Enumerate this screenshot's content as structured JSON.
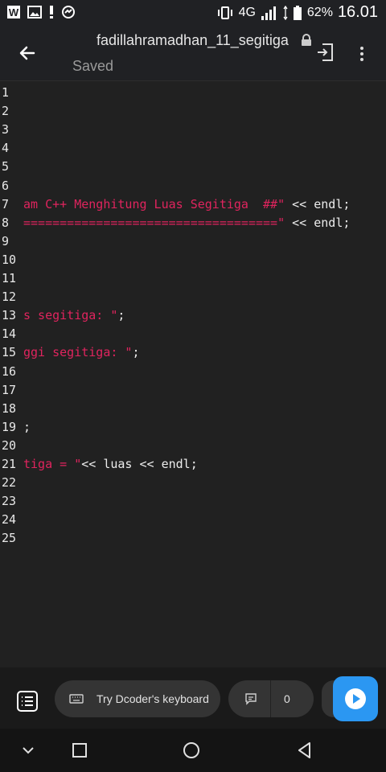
{
  "status_bar": {
    "network": "4G",
    "battery": "62%",
    "time": "16.01"
  },
  "app_bar": {
    "title": "fadillahramadhan_11_segitiga",
    "status": "Saved"
  },
  "editor": {
    "lines": [
      {
        "n": "1",
        "str": "",
        "rest": ""
      },
      {
        "n": "2",
        "str": "",
        "rest": ""
      },
      {
        "n": "3",
        "str": "",
        "rest": ""
      },
      {
        "n": "4",
        "str": "",
        "rest": ""
      },
      {
        "n": "5",
        "str": "",
        "rest": ""
      },
      {
        "n": "6",
        "str": "",
        "rest": ""
      },
      {
        "n": "7",
        "str": "am C++ Menghitung Luas Segitiga  ##\"",
        "rest": " << endl;"
      },
      {
        "n": "8",
        "str": "===================================\"",
        "rest": " << endl;"
      },
      {
        "n": "9",
        "str": "",
        "rest": ""
      },
      {
        "n": "10",
        "str": "",
        "rest": ""
      },
      {
        "n": "11",
        "str": "",
        "rest": ""
      },
      {
        "n": "12",
        "str": "",
        "rest": ""
      },
      {
        "n": "13",
        "str": "s segitiga: \"",
        "rest": ";"
      },
      {
        "n": "14",
        "str": "",
        "rest": ""
      },
      {
        "n": "15",
        "str": "ggi segitiga: \"",
        "rest": ";"
      },
      {
        "n": "16",
        "str": "",
        "rest": ""
      },
      {
        "n": "17",
        "str": "",
        "rest": ""
      },
      {
        "n": "18",
        "str": "",
        "rest": ""
      },
      {
        "n": "19",
        "str": "",
        "rest": ";"
      },
      {
        "n": "20",
        "str": "",
        "rest": ""
      },
      {
        "n": "21",
        "str": "tiga = \"",
        "rest": "<< luas << endl;"
      },
      {
        "n": "22",
        "str": "",
        "rest": ""
      },
      {
        "n": "23",
        "str": "",
        "rest": ""
      },
      {
        "n": "24",
        "str": "",
        "rest": ""
      },
      {
        "n": "25",
        "str": "",
        "rest": ""
      }
    ]
  },
  "toolbar": {
    "keyboard_label": "Try Dcoder's keyboard",
    "comment_count": "0"
  },
  "colors": {
    "string": "#e0245e",
    "run_button": "#2b97f2",
    "background": "#212121"
  },
  "icons": [
    "back-arrow-icon",
    "lock-icon",
    "export-icon",
    "more-vert-icon",
    "list-menu-icon",
    "keyboard-icon",
    "comment-icon",
    "play-icon",
    "nav-back-icon",
    "nav-home-icon",
    "nav-recents-icon",
    "nav-down-icon"
  ]
}
